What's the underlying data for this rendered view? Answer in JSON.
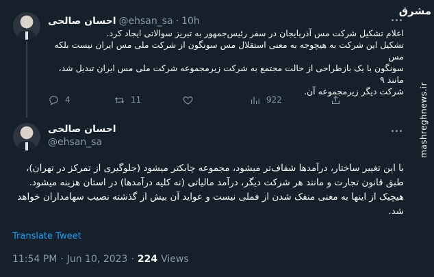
{
  "watermark": {
    "logo_text": "مشرق",
    "site": "mashreghnews.ir"
  },
  "reply_tweet": {
    "display_name": "احسان صالحی",
    "handle": "@ehsan_sa",
    "separator": "·",
    "time": "10h",
    "text_lines": [
      "اعلام تشکیل شرکت مس آذربایجان در سفر رئیس‌جمهور به تبریز سوالاتی ایجاد کرد.",
      "تشکیل این شرکت به هیچوجه به معنی استقلال مس سونگون از شرکت ملی مس ایران نیست بلکه مس",
      "سونگون با یک بازطراحی از حالت مجتمع به شرکت زیرمجموعه شرکت ملی مس ایران تبدیل شد، مانند ۹",
      "شرکت دیگر زیرمجموعه آن."
    ],
    "actions": {
      "replies": "4",
      "retweets": "11",
      "likes": "",
      "views": "922"
    }
  },
  "main_tweet": {
    "display_name": "احسان صالحی",
    "handle": "@ehsan_sa",
    "text_lines": [
      "با این تغییر ساختار، درآمدها شفاف‌تر میشود، مجموعه چابکتر  میشود (جلوگیری از تمرکز در تهران)،",
      "طبق قانون تجارت و مانند هر شرکت دیگر، درآمد مالیاتی (نه کلیه درآمدها) در استان هزینه میشود.",
      "هیچیک از اینها به معنی منفک شدن از فملی نیست و عواید آن بیش از گذشته نصیب سهامداران خواهد",
      "شد."
    ],
    "translate_label": "Translate Tweet",
    "time": "11:54 PM",
    "date": "Jun 10, 2023",
    "separator": "·",
    "views_count": "224",
    "views_label": "Views"
  },
  "colors": {
    "background": "#15202b",
    "text_primary": "#f7f9f9",
    "text_secondary": "#8b98a5",
    "link": "#1d9bf0",
    "divider": "#38444d"
  },
  "icons": [
    "reply-icon",
    "retweet-icon",
    "like-icon",
    "views-icon",
    "share-icon",
    "more-icon"
  ]
}
